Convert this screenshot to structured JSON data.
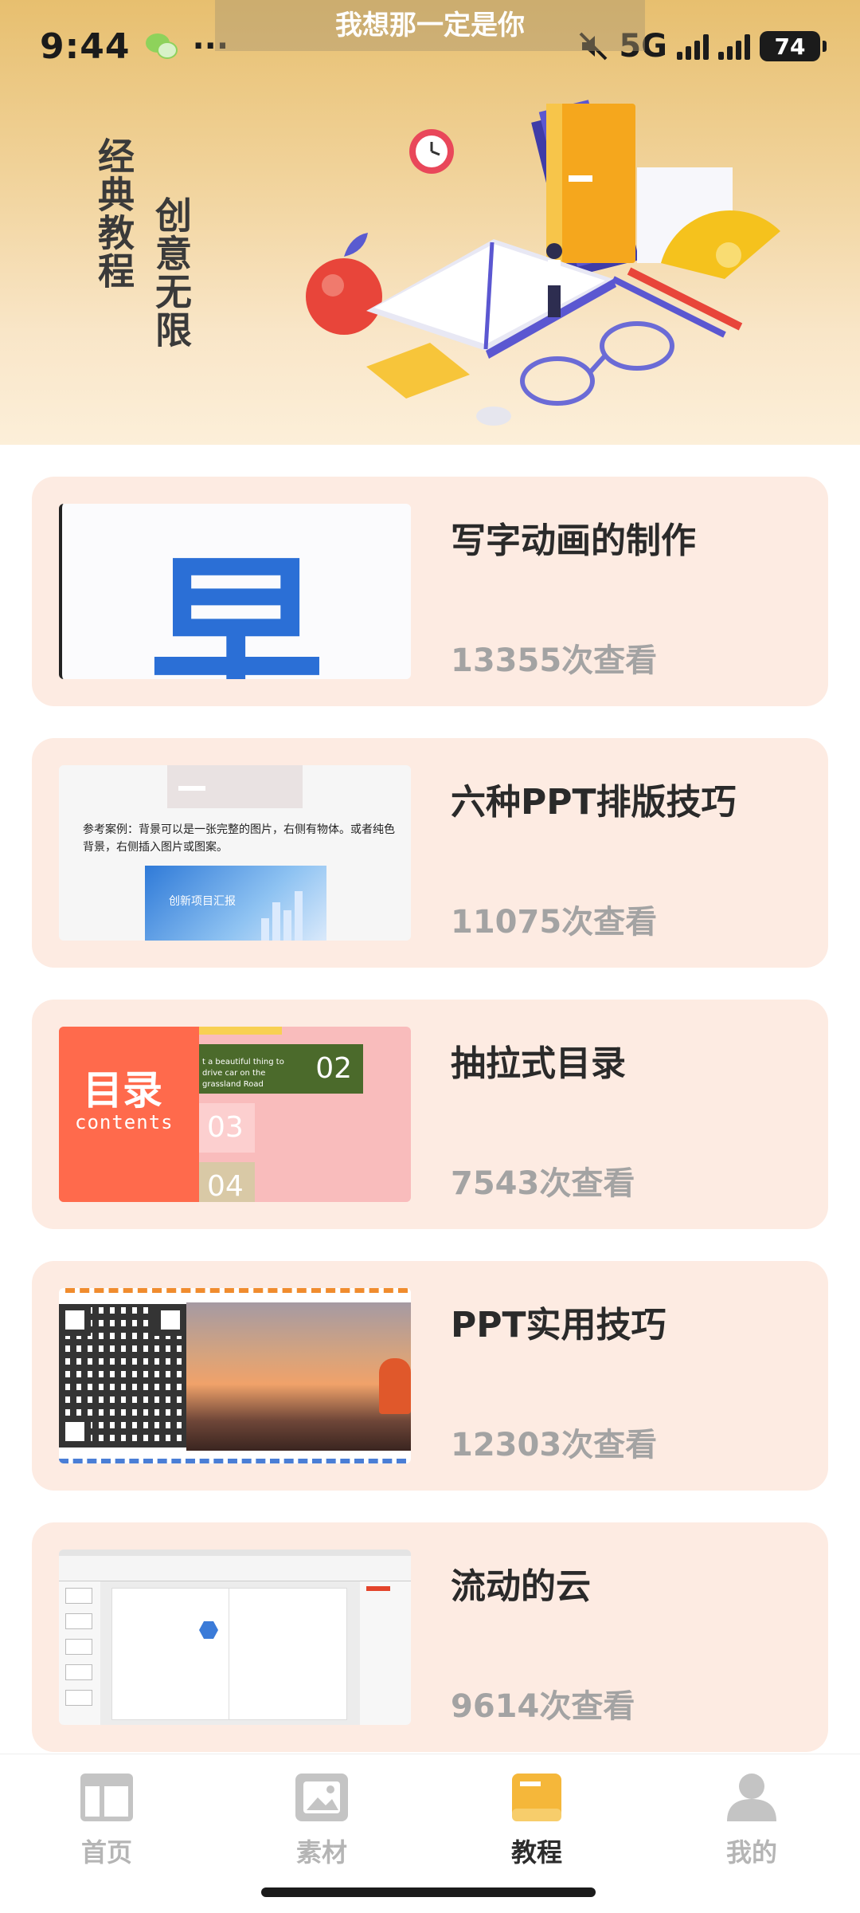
{
  "status_bar": {
    "time": "9:44",
    "network": "5G",
    "battery": "74",
    "toast_text": "我想那一定是你"
  },
  "banner": {
    "slogan_left": "经典教程",
    "slogan_right": "创意无限"
  },
  "tutorials": [
    {
      "title": "写字动画的制作",
      "views": "13355次查看",
      "thumb_glyph": "早"
    },
    {
      "title": "六种PPT排版技巧",
      "views": "11075次查看",
      "thumb_text": "参考案例：背景可以是一张完整的图片，右侧有物体。或者纯色背景，右侧插入图片或图案。",
      "thumb_caption": "创新项目汇报"
    },
    {
      "title": "抽拉式目录",
      "views": "7543次查看",
      "thumb_heading": "目录",
      "thumb_sub": "contents",
      "thumb_line": "t a beautiful thing to drive car on the grassland Road",
      "n02": "02",
      "n03": "03",
      "n04": "04"
    },
    {
      "title": "PPT实用技巧",
      "views": "12303次查看"
    },
    {
      "title": "流动的云",
      "views": "9614次查看"
    }
  ],
  "tabbar": {
    "items": [
      {
        "label": "首页",
        "icon": "home-layout-icon",
        "active": false
      },
      {
        "label": "素材",
        "icon": "image-icon",
        "active": false
      },
      {
        "label": "教程",
        "icon": "book-icon",
        "active": true
      },
      {
        "label": "我的",
        "icon": "person-icon",
        "active": false
      }
    ]
  },
  "colors": {
    "card_bg": "#fdebe2",
    "active_tab": "#f5b73a",
    "inactive_tab": "#c4c4c4"
  }
}
